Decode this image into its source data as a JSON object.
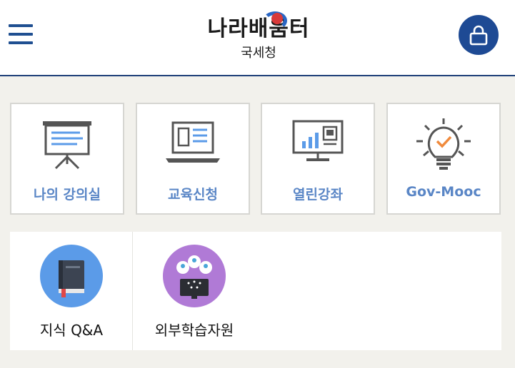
{
  "header": {
    "logo_title": "나라배움터",
    "logo_subtitle": "국세청",
    "menu_icon": "hamburger-menu-icon",
    "lock_icon": "lock-icon",
    "brand_color": "#1e4a94"
  },
  "tiles": [
    {
      "label": "나의 강의실",
      "icon": "presentation-board-icon"
    },
    {
      "label": "교육신청",
      "icon": "laptop-icon"
    },
    {
      "label": "열린강좌",
      "icon": "monitor-chart-icon"
    },
    {
      "label": "Gov-Mooc",
      "icon": "lightbulb-icon"
    }
  ],
  "resources": [
    {
      "label": "지식 Q&A",
      "icon": "book-icon",
      "color": "#5b9be8"
    },
    {
      "label": "외부학습자원",
      "icon": "network-users-icon",
      "color": "#b07ad6"
    }
  ],
  "tile_label_color": "#5a86c6"
}
